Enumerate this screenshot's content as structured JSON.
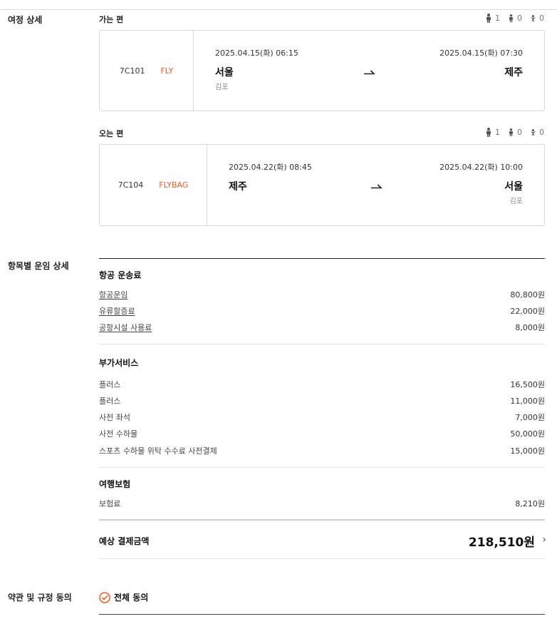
{
  "colors": {
    "accent": "#f05a22"
  },
  "itinerary": {
    "label": "여정 상세",
    "outbound": {
      "title": "가는 편",
      "pax": {
        "adult": "1",
        "child": "0",
        "infant": "0"
      },
      "flight_no": "7C101",
      "fare_type": "FLY",
      "dep_time": "2025.04.15(화) 06:15",
      "arr_time": "2025.04.15(화) 07:30",
      "dep_city": "서울",
      "dep_airport": "김포",
      "arr_city": "제주",
      "arr_airport": ""
    },
    "inbound": {
      "title": "오는 편",
      "pax": {
        "adult": "1",
        "child": "0",
        "infant": "0"
      },
      "flight_no": "7C104",
      "fare_type": "FLYBAG",
      "dep_time": "2025.04.22(화) 08:45",
      "arr_time": "2025.04.22(화) 10:00",
      "dep_city": "제주",
      "dep_airport": "",
      "arr_city": "서울",
      "arr_airport": "김포"
    }
  },
  "fares": {
    "label": "항목별 운임 상세",
    "air": {
      "title": "항공 운송료",
      "items": [
        {
          "label": "항공운임",
          "value": "80,800원"
        },
        {
          "label": "유류할증료",
          "value": "22,000원"
        },
        {
          "label": "공항시설 사용료",
          "value": "8,000원"
        }
      ]
    },
    "extra": {
      "title": "부가서비스",
      "items": [
        {
          "label": "플러스",
          "value": "16,500원"
        },
        {
          "label": "플러스",
          "value": "11,000원"
        },
        {
          "label": "사전 좌석",
          "value": "7,000원"
        },
        {
          "label": "사전 수하물",
          "value": "50,000원"
        },
        {
          "label": "스포츠 수하물 위탁 수수료 사전결제",
          "value": "15,000원"
        }
      ]
    },
    "insurance": {
      "title": "여행보험",
      "items": [
        {
          "label": "보험료",
          "value": "8,210원"
        }
      ]
    },
    "total": {
      "label": "예상 결제금액",
      "value": "218,510원"
    }
  },
  "terms": {
    "label": "약관 및 규정 동의",
    "agree_all": "전체 동의"
  }
}
